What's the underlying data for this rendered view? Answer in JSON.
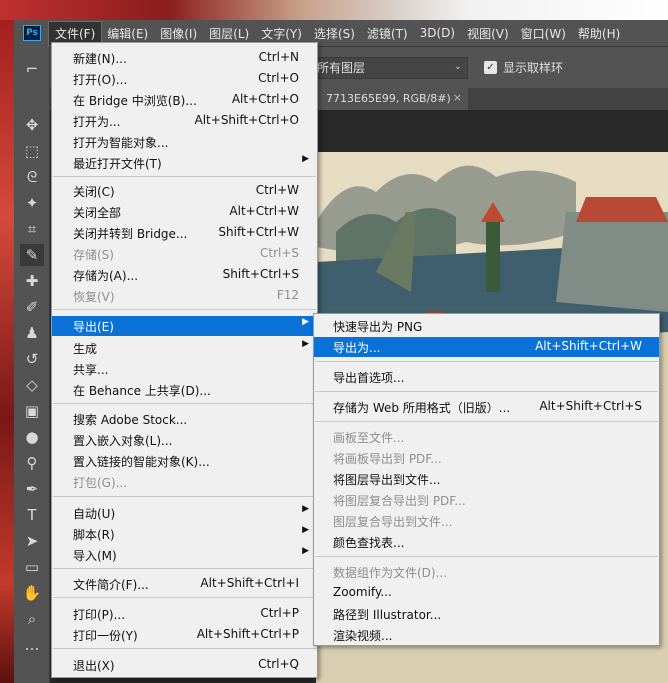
{
  "menubar": {
    "logo": "Ps",
    "items": [
      "文件(F)",
      "编辑(E)",
      "图像(I)",
      "图层(L)",
      "文字(Y)",
      "选择(S)",
      "滤镜(T)",
      "3D(D)",
      "视图(V)",
      "窗口(W)",
      "帮助(H)"
    ]
  },
  "options": {
    "sample_value": "所有图层",
    "show_ring_label": "显示取样环"
  },
  "tab": {
    "title": "7713E65E99, RGB/8#)",
    "close": "×"
  },
  "file_menu": [
    {
      "label": "新建(N)...",
      "shortcut": "Ctrl+N"
    },
    {
      "label": "打开(O)...",
      "shortcut": "Ctrl+O"
    },
    {
      "label": "在 Bridge 中浏览(B)...",
      "shortcut": "Alt+Ctrl+O"
    },
    {
      "label": "打开为...",
      "shortcut": "Alt+Shift+Ctrl+O"
    },
    {
      "label": "打开为智能对象..."
    },
    {
      "label": "最近打开文件(T)",
      "submenu": true
    },
    {
      "label": "关闭(C)",
      "shortcut": "Ctrl+W"
    },
    {
      "label": "关闭全部",
      "shortcut": "Alt+Ctrl+W"
    },
    {
      "label": "关闭并转到 Bridge...",
      "shortcut": "Shift+Ctrl+W"
    },
    {
      "label": "存储(S)",
      "shortcut": "Ctrl+S",
      "disabled": true
    },
    {
      "label": "存储为(A)...",
      "shortcut": "Shift+Ctrl+S"
    },
    {
      "label": "恢复(V)",
      "shortcut": "F12",
      "disabled": true
    },
    {
      "label": "导出(E)",
      "submenu": true,
      "highlighted": true
    },
    {
      "label": "生成",
      "submenu": true
    },
    {
      "label": "共享..."
    },
    {
      "label": "在 Behance 上共享(D)..."
    },
    {
      "label": "搜索 Adobe Stock..."
    },
    {
      "label": "置入嵌入对象(L)..."
    },
    {
      "label": "置入链接的智能对象(K)..."
    },
    {
      "label": "打包(G)...",
      "disabled": true
    },
    {
      "label": "自动(U)",
      "submenu": true
    },
    {
      "label": "脚本(R)",
      "submenu": true
    },
    {
      "label": "导入(M)",
      "submenu": true
    },
    {
      "label": "文件简介(F)...",
      "shortcut": "Alt+Shift+Ctrl+I"
    },
    {
      "label": "打印(P)...",
      "shortcut": "Ctrl+P"
    },
    {
      "label": "打印一份(Y)",
      "shortcut": "Alt+Shift+Ctrl+P"
    },
    {
      "label": "退出(X)",
      "shortcut": "Ctrl+Q"
    }
  ],
  "export_menu": [
    {
      "label": "快速导出为 PNG"
    },
    {
      "label": "导出为...",
      "shortcut": "Alt+Shift+Ctrl+W",
      "highlighted": true
    },
    {
      "label": "导出首选项..."
    },
    {
      "label": "存储为 Web 所用格式（旧版）...",
      "shortcut": "Alt+Shift+Ctrl+S"
    },
    {
      "label": "画板至文件...",
      "disabled": true
    },
    {
      "label": "将画板导出到 PDF...",
      "disabled": true
    },
    {
      "label": "将图层导出到文件..."
    },
    {
      "label": "将图层复合导出到 PDF...",
      "disabled": true
    },
    {
      "label": "图层复合导出到文件...",
      "disabled": true
    },
    {
      "label": "颜色查找表..."
    },
    {
      "label": "数据组作为文件(D)...",
      "disabled": true
    },
    {
      "label": "Zoomify..."
    },
    {
      "label": "路径到 Illustrator..."
    },
    {
      "label": "渲染视频..."
    }
  ],
  "icons": [
    "eyedropper-icon",
    "move-icon",
    "marquee-icon",
    "lasso-icon",
    "magic-wand-icon",
    "crop-icon",
    "healing-icon",
    "brush-icon",
    "stamp-icon",
    "history-brush-icon",
    "eraser-icon",
    "gradient-icon",
    "blur-icon",
    "dodge-icon",
    "pen-icon",
    "type-icon",
    "path-select-icon",
    "rectangle-icon",
    "hand-icon",
    "zoom-icon",
    "more-icon"
  ],
  "colors": {
    "highlight": "#0a71d6",
    "menu_bg": "#f0f0f0",
    "ui_gray": "#535353"
  }
}
